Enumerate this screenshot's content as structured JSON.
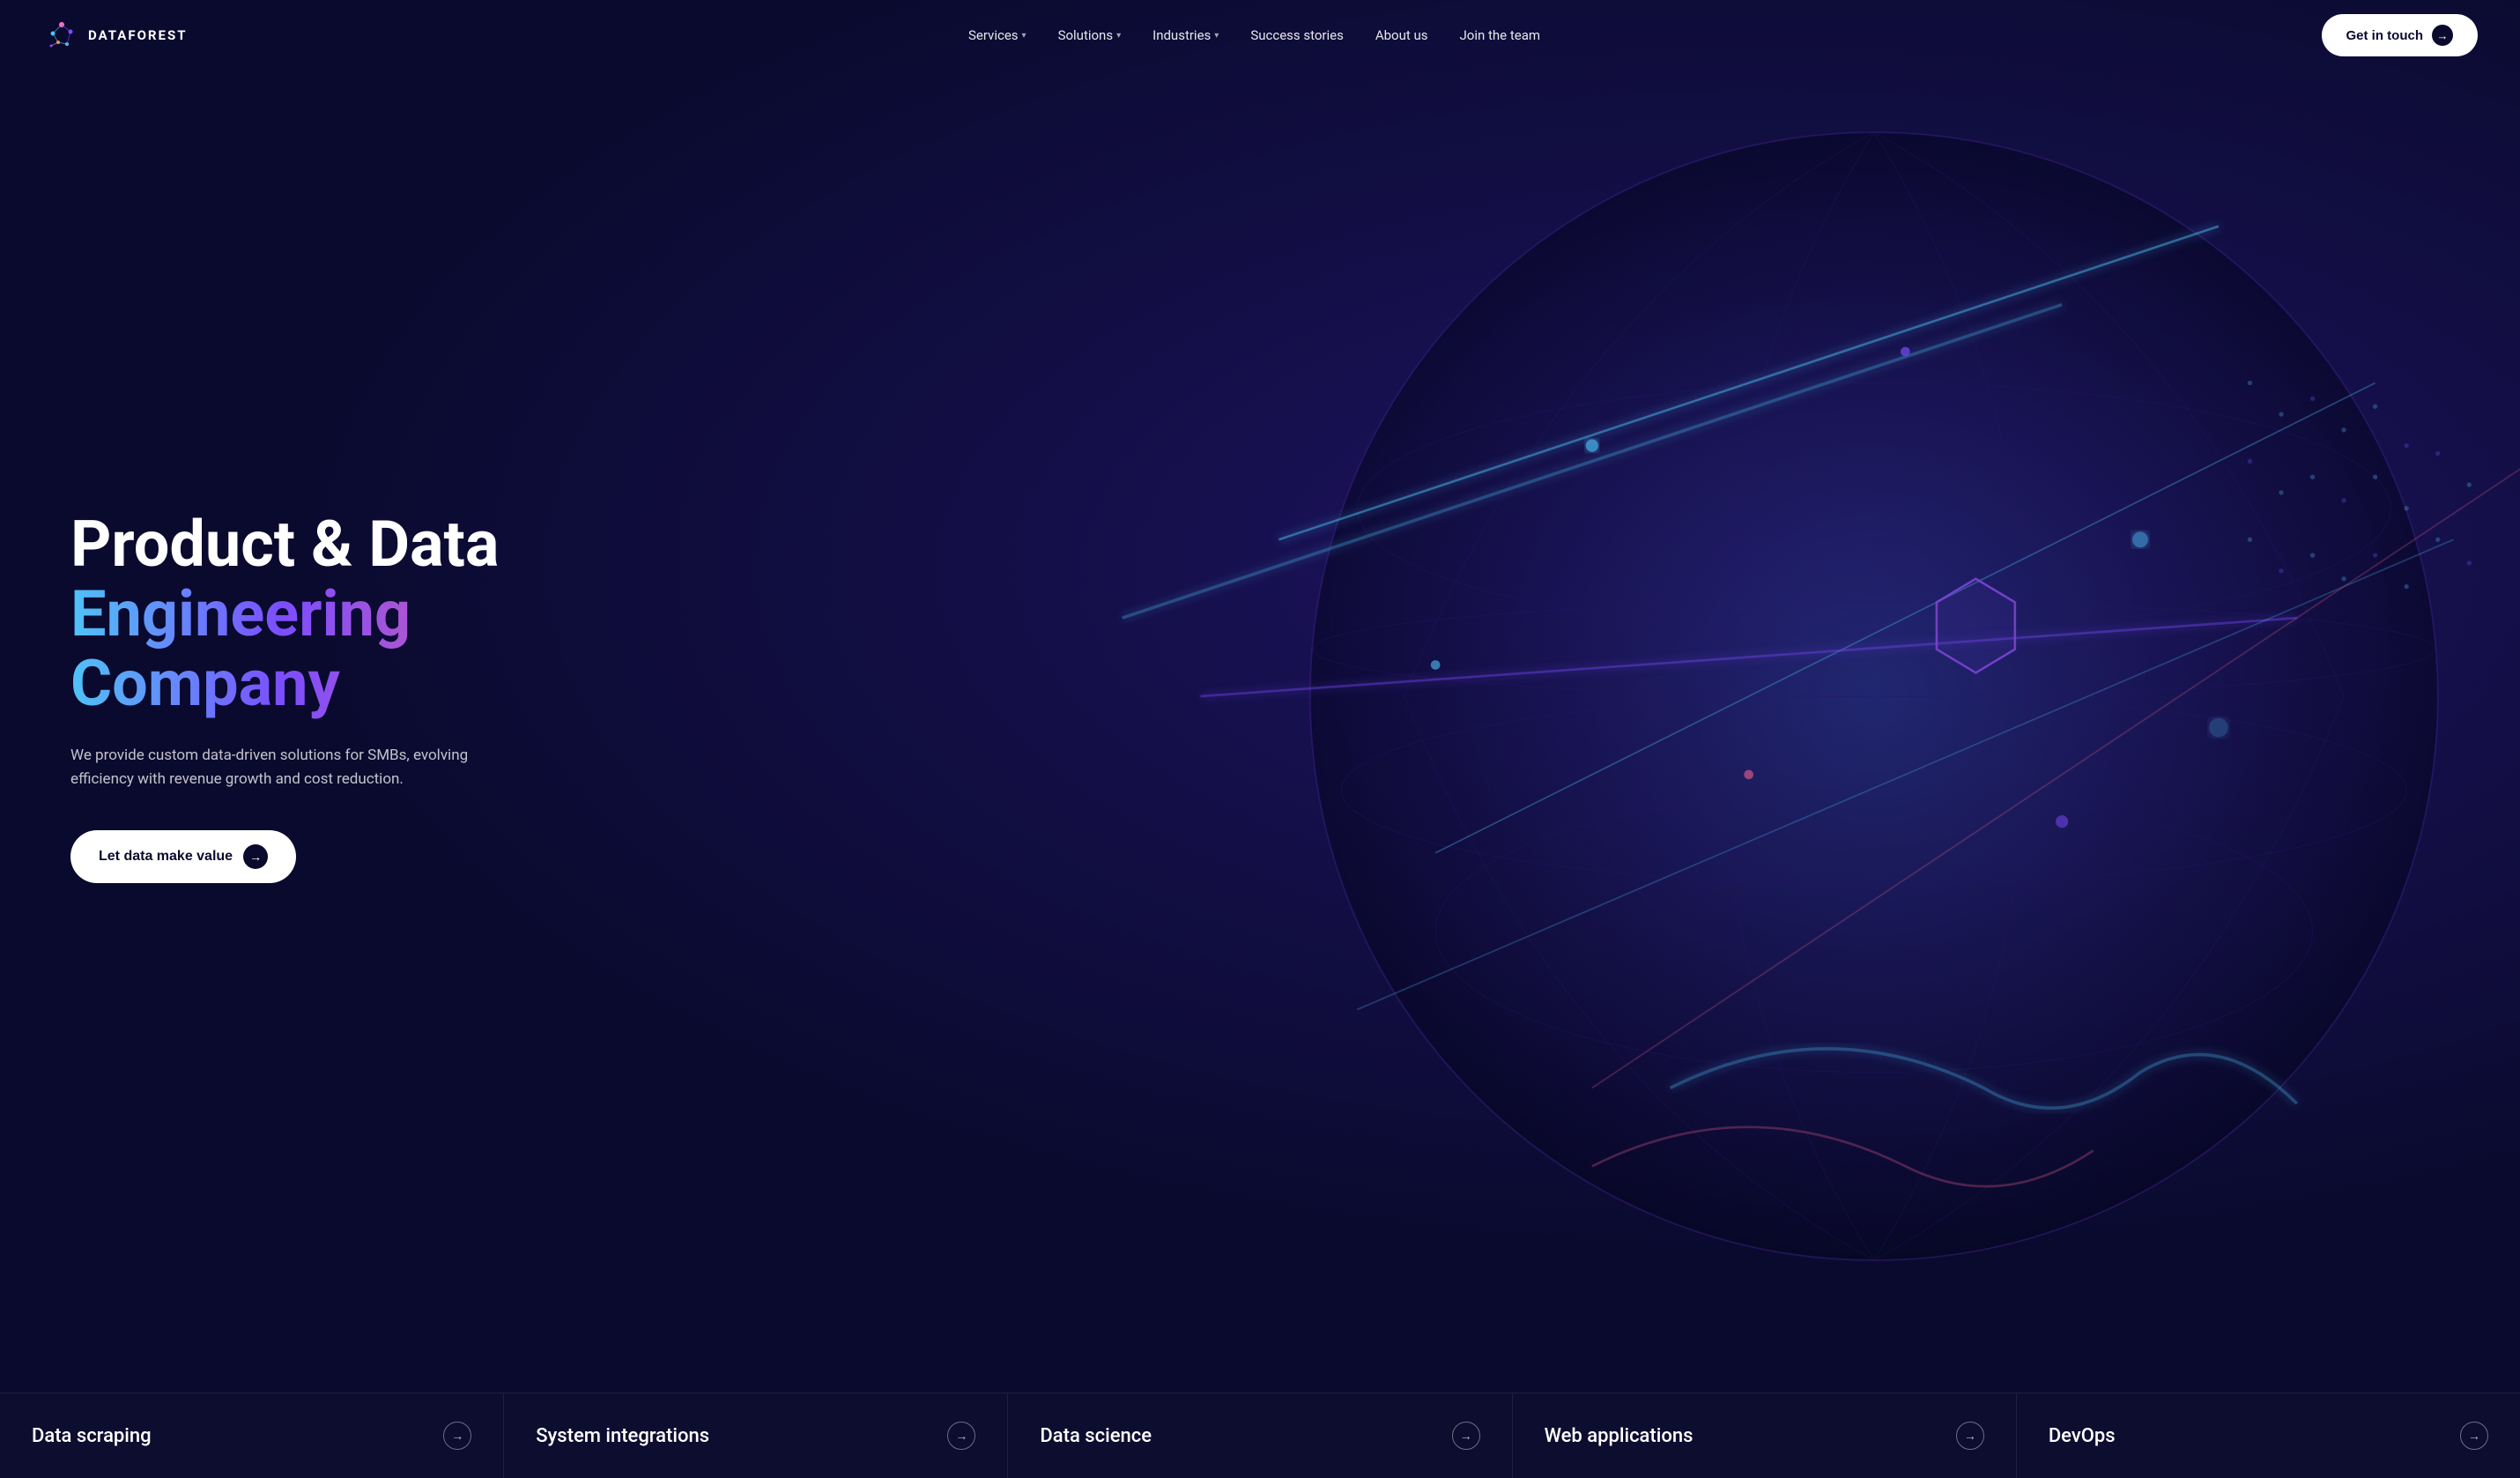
{
  "logo": {
    "text": "DATAFOREST"
  },
  "nav": {
    "links": [
      {
        "label": "Services",
        "has_dropdown": true,
        "id": "services"
      },
      {
        "label": "Solutions",
        "has_dropdown": true,
        "id": "solutions"
      },
      {
        "label": "Industries",
        "has_dropdown": true,
        "id": "industries"
      },
      {
        "label": "Success stories",
        "has_dropdown": false,
        "id": "success-stories"
      },
      {
        "label": "About us",
        "has_dropdown": false,
        "id": "about-us"
      },
      {
        "label": "Join the team",
        "has_dropdown": false,
        "id": "join-the-team"
      }
    ],
    "cta_label": "Get in touch",
    "cta_arrow": "→"
  },
  "hero": {
    "title_line1": "Product & Data",
    "title_line2": "Engineering Company",
    "subtitle": "We provide custom data-driven solutions for SMBs, evolving efficiency with revenue growth and cost reduction.",
    "cta_label": "Let data make value",
    "cta_arrow": "→"
  },
  "services_bar": [
    {
      "name": "Data scraping",
      "arrow": "→"
    },
    {
      "name": "System integrations",
      "arrow": "→"
    },
    {
      "name": "Data science",
      "arrow": "→"
    },
    {
      "name": "Web applications",
      "arrow": "→"
    },
    {
      "name": "DevOps",
      "arrow": "→"
    }
  ]
}
